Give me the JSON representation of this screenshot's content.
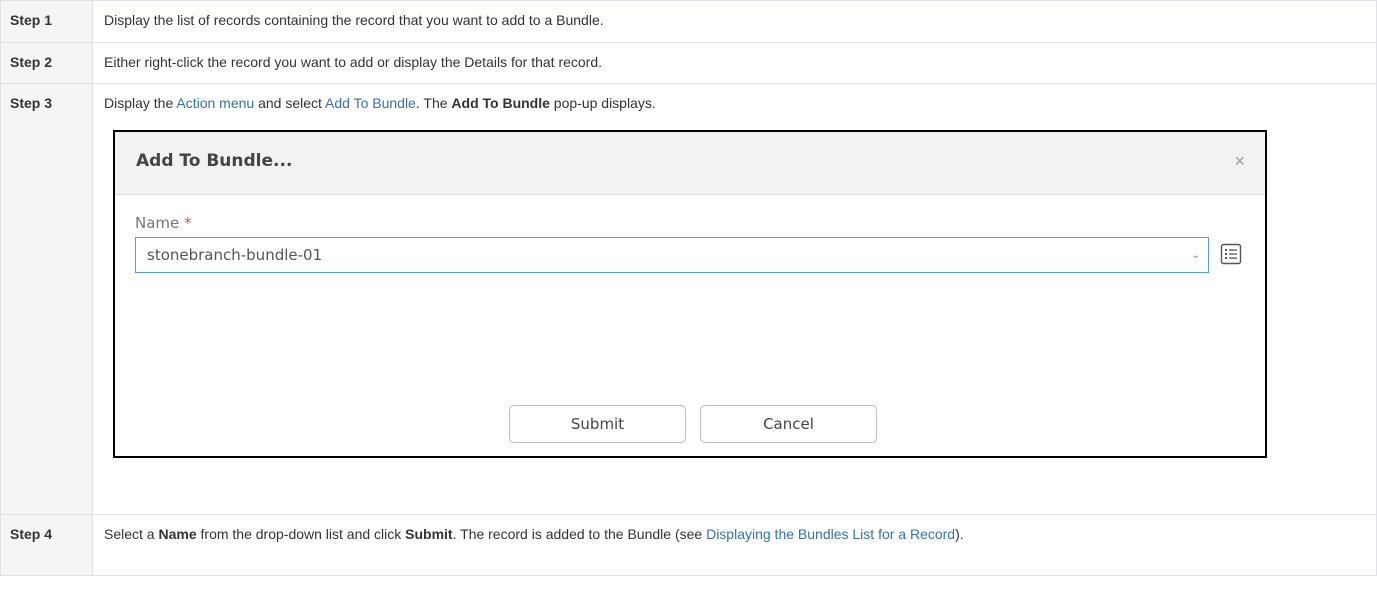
{
  "steps": [
    {
      "label": "Step 1",
      "text": "Display the list of records containing the record that you want to add to a Bundle."
    },
    {
      "label": "Step 2",
      "text": "Either right-click the record you want to add or display the Details for that record."
    },
    {
      "label": "Step 3",
      "text_a": "Display the ",
      "link_action_menu": "Action menu",
      "text_b": " and select ",
      "link_add_to_bundle": "Add To Bundle",
      "text_c": ". The ",
      "bold_add_to_bundle": "Add To Bundle",
      "text_d": " pop-up displays."
    },
    {
      "label": "Step 4",
      "text_a": "Select a ",
      "bold_name": "Name",
      "text_b": " from the drop-down list and click ",
      "bold_submit": "Submit",
      "text_c": ". The record is added to the Bundle (see ",
      "link_displaying": "Displaying the Bundles List for a Record",
      "text_d": ")."
    }
  ],
  "dialog": {
    "title": "Add To Bundle...",
    "close_glyph": "×",
    "name_label": "Name",
    "required_mark": "*",
    "name_value": "stonebranch-bundle-01",
    "chevron_glyph": "⌄",
    "submit_label": "Submit",
    "cancel_label": "Cancel"
  },
  "colors": {
    "link": "#3572b0",
    "label_bg": "#f4f5f7",
    "select_border": "#56a0d8",
    "required": "#e2534d"
  },
  "icons": [
    "close-icon",
    "chevron-down-icon",
    "list-details-icon"
  ]
}
